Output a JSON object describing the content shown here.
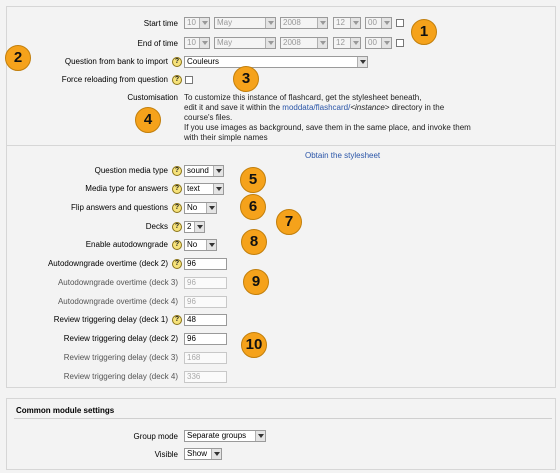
{
  "schedule": {
    "start_label": "Start time",
    "end_label": "End of time",
    "start": {
      "day": "10",
      "month": "May",
      "year": "2008",
      "hour": "12",
      "minute": "00"
    },
    "end": {
      "day": "10",
      "month": "May",
      "year": "2008",
      "hour": "12",
      "minute": "00"
    }
  },
  "question_bank": {
    "label": "Question from bank to import",
    "value": "Couleurs"
  },
  "force_reload": {
    "label": "Force reloading from question"
  },
  "customisation": {
    "label": "Customisation",
    "line1": "To customize this instance of flashcard, get the stylesheet beneath,",
    "line2_pre": "edit it and save it within the ",
    "line2_link": "moddata/flashcard/",
    "line2_italic": "<instance>",
    "line2_post": " directory in the",
    "line3": "course's files.",
    "line4": "If you use images as background, save them in the same place, and invoke them",
    "line5": "with their simple names",
    "stylesheet_link": "Obtain the stylesheet"
  },
  "options": {
    "question_media_label": "Question media type",
    "question_media_value": "sound",
    "answer_media_label": "Media type for answers",
    "answer_media_value": "text",
    "flip_label": "Flip answers and questions",
    "flip_value": "No",
    "decks_label": "Decks",
    "decks_value": "2",
    "autodowngrade_label": "Enable autodowngrade",
    "autodowngrade_value": "No",
    "overtime_deck2_label": "Autodowngrade overtime (deck 2)",
    "overtime_deck2_value": "96",
    "overtime_deck3_label": "Autodowngrade overtime (deck 3)",
    "overtime_deck3_value": "96",
    "overtime_deck4_label": "Autodowngrade overtime (deck 4)",
    "overtime_deck4_value": "96",
    "review_deck1_label": "Review triggering delay (deck 1)",
    "review_deck1_value": "48",
    "review_deck2_label": "Review triggering delay (deck 2)",
    "review_deck2_value": "96",
    "review_deck3_label": "Review triggering delay (deck 3)",
    "review_deck3_value": "168",
    "review_deck4_label": "Review triggering delay (deck 4)",
    "review_deck4_value": "336"
  },
  "common": {
    "title": "Common module settings",
    "group_mode_label": "Group mode",
    "group_mode_value": "Separate groups",
    "visible_label": "Visible",
    "visible_value": "Show"
  },
  "help_glyph": "?",
  "badges": [
    "1",
    "2",
    "3",
    "4",
    "5",
    "6",
    "7",
    "8",
    "9",
    "10"
  ],
  "colors": {
    "badge": "#f5a21b",
    "link": "#2a55a8",
    "help": "#f6e27a"
  }
}
